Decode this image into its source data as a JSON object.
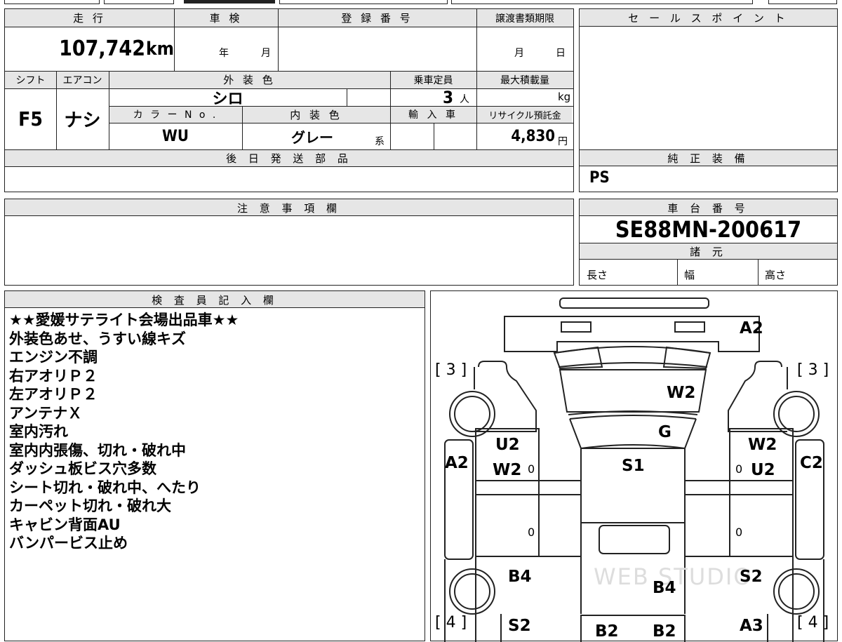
{
  "vehicle": {
    "mileage_label": "走 行",
    "mileage": "107,742",
    "mileage_unit": "km",
    "inspection_label": "車 検",
    "inspection_year": "年",
    "inspection_month": "月",
    "registration_label": "登 録 番 号",
    "transfer_label": "譲渡書類期限",
    "transfer_month": "月",
    "transfer_day": "日",
    "shift_label": "シフト",
    "shift": "F5",
    "ac_label": "エアコン",
    "ac": "ナシ",
    "exterior_color_label": "外 装 色",
    "exterior_color": "シロ",
    "capacity_label": "乗車定員",
    "capacity": "3",
    "capacity_unit": "人",
    "max_load_label": "最大積載量",
    "max_load_unit": "kg",
    "color_no_label": "カ ラ ー N o .",
    "color_no": "WU",
    "interior_color_label": "内 装 色",
    "interior_color": "グレー",
    "interior_suffix": "系",
    "import_label": "輸 入 車",
    "recycle_label": "リサイクル預託金",
    "recycle_fee": "4,830",
    "recycle_unit": "円"
  },
  "later_parts_label": "後 日 発 送 部 品",
  "sales_point_label": "セ ー ル ス ポ イ ン ト",
  "genuine_label": "純 正 装 備",
  "genuine_equipment": "PS",
  "caution_label": "注 意 事 項 欄",
  "chassis": {
    "label": "車 台 番 号",
    "number": "SE88MN-200617",
    "specs_label": "諸 元",
    "length_label": "長さ",
    "width_label": "幅",
    "height_label": "高さ"
  },
  "inspector": {
    "label": "検 査 員 記 入 欄",
    "notes": [
      "★★愛媛サテライト会場出品車★★",
      "外装色あせ、うすい線キズ",
      "エンジン不調",
      "右アオリＰ２",
      "左アオリＰ２",
      "アンテナＸ",
      "室内汚れ",
      "室内内張傷、切れ・破れ中",
      "ダッシュ板ビス穴多数",
      "シート切れ・破れ中、へたり",
      "カーペット切れ・破れ大",
      "キャビン背面AU",
      "バンパービス止め"
    ]
  },
  "diagram": {
    "marks": {
      "top_a2": "A2",
      "w2_windshield": "W2",
      "g_hood": "G",
      "s1_roof": "S1",
      "u2_left": "U2",
      "w2_left": "W2",
      "w2_right": "W2",
      "u2_right": "U2",
      "a2_left": "A2",
      "c2_right": "C2",
      "b4_left": "B4",
      "b4_center": "B4",
      "s2_right": "S2",
      "s2_left": "S2",
      "a3_right": "A3",
      "b2_a": "B2",
      "b2_b": "B2",
      "zero_1": "0",
      "zero_2": "0",
      "zero_3": "0",
      "zero_4": "0"
    },
    "corner_tl": "[ 3 ]",
    "corner_tr": "[ 3 ]",
    "corner_bl": "[ 4 ]",
    "corner_br": "[ 4 ]",
    "watermark": "WEB STUDIO"
  }
}
